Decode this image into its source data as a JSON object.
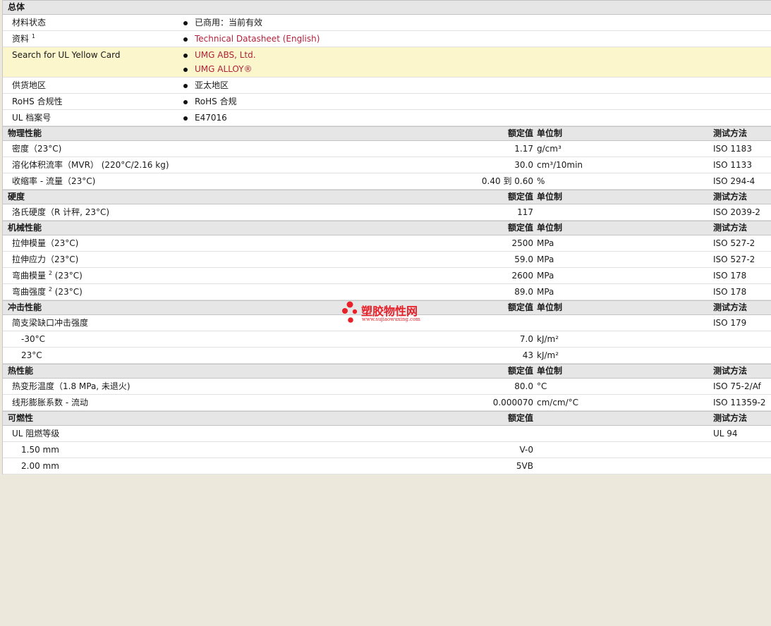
{
  "general": {
    "title": "总体",
    "rows": [
      {
        "label": "材料状态",
        "items": [
          {
            "text": "已商用：当前有效"
          }
        ]
      },
      {
        "label": "资料",
        "sup": "1",
        "items": [
          {
            "text": "Technical Datasheet (English)",
            "link": true
          }
        ]
      },
      {
        "label": "Search for UL Yellow Card",
        "items": [
          {
            "text": "UMG ABS, Ltd.",
            "link": true
          },
          {
            "text": "UMG ALLOY®",
            "link": true
          }
        ]
      },
      {
        "label": "供货地区",
        "items": [
          {
            "text": "亚太地区"
          }
        ]
      },
      {
        "label": "RoHS 合规性",
        "items": [
          {
            "text": "RoHS 合规"
          }
        ]
      },
      {
        "label": "UL 档案号",
        "items": [
          {
            "text": "E47016"
          }
        ]
      }
    ]
  },
  "columns": {
    "value": "额定值",
    "unit": "单位制",
    "method": "测试方法"
  },
  "sections": [
    {
      "title": "物理性能",
      "show_unit": true,
      "rows": [
        {
          "label": "密度（23°C)",
          "value": "1.17",
          "unit": "g/cm³",
          "method": "ISO 1183"
        },
        {
          "label": "溶化体积流率（MVR） (220°C/2.16 kg)",
          "value": "30.0",
          "unit": "cm³/10min",
          "method": "ISO 1133"
        },
        {
          "label": "收缩率  - 流量（23°C)",
          "value": "0.40 到  0.60",
          "unit": "%",
          "method": "ISO 294-4"
        }
      ]
    },
    {
      "title": "硬度",
      "show_unit": true,
      "rows": [
        {
          "label": "洛氏硬度（R 计秤, 23°C)",
          "value": "117",
          "unit": "",
          "method": "ISO 2039-2"
        }
      ]
    },
    {
      "title": "机械性能",
      "show_unit": true,
      "rows": [
        {
          "label": "拉伸模量（23°C)",
          "value": "2500",
          "unit": "MPa",
          "method": "ISO 527-2"
        },
        {
          "label": "拉伸应力（23°C)",
          "value": "59.0",
          "unit": "MPa",
          "method": "ISO 527-2"
        },
        {
          "label": "弯曲模量",
          "sup": "2",
          "suffix": " (23°C)",
          "value": "2600",
          "unit": "MPa",
          "method": "ISO 178"
        },
        {
          "label": "弯曲强度",
          "sup": "2",
          "suffix": " (23°C)",
          "value": "89.0",
          "unit": "MPa",
          "method": "ISO 178"
        }
      ]
    },
    {
      "title": "冲击性能",
      "show_unit": true,
      "rows": [
        {
          "label": "简支梁缺口冲击强度",
          "value": "",
          "unit": "",
          "method": "ISO 179"
        },
        {
          "label": "-30°C",
          "indent": true,
          "value": "7.0",
          "unit": "kJ/m²",
          "method": ""
        },
        {
          "label": "23°C",
          "indent": true,
          "value": "43",
          "unit": "kJ/m²",
          "method": ""
        }
      ]
    },
    {
      "title": "热性能",
      "show_unit": true,
      "rows": [
        {
          "label": "热变形温度（1.8 MPa, 未退火)",
          "value": "80.0",
          "unit": "°C",
          "method": "ISO 75-2/Af"
        },
        {
          "label": "线形膨胀系数  - 流动",
          "value": "0.000070",
          "unit": "cm/cm/°C",
          "method": "ISO 11359-2"
        }
      ]
    },
    {
      "title": "可燃性",
      "show_unit": false,
      "rows": [
        {
          "label": "UL 阻燃等级",
          "value": "",
          "unit": "",
          "method": "UL 94"
        },
        {
          "label": "1.50 mm",
          "indent": true,
          "value": "V-0",
          "unit": "",
          "method": ""
        },
        {
          "label": "2.00 mm",
          "indent": true,
          "value": "5VB",
          "unit": "",
          "method": ""
        }
      ]
    }
  ],
  "watermark": {
    "title": "塑胶物性网",
    "url": "www.sujiaowuxing.com",
    "color": "#e8202a"
  }
}
